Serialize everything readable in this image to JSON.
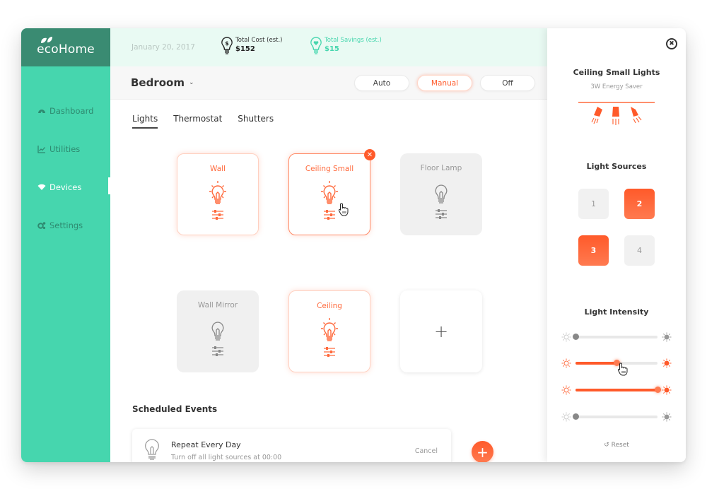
{
  "app": {
    "name": "ecoHome"
  },
  "header": {
    "date": "January 20, 2017",
    "total_cost": {
      "label": "Total Cost (est.)",
      "value": "$152"
    },
    "total_savings": {
      "label": "Total Savings (est.)",
      "value": "$15"
    }
  },
  "sidebar": {
    "items": [
      {
        "label": "Dashboard",
        "icon": "dashboard-gauge-icon",
        "active": false
      },
      {
        "label": "Utilities",
        "icon": "line-chart-icon",
        "active": false
      },
      {
        "label": "Devices",
        "icon": "wifi-icon",
        "active": true
      },
      {
        "label": "Settings",
        "icon": "gears-icon",
        "active": false
      }
    ]
  },
  "room": {
    "name": "Bedroom",
    "modes": [
      {
        "label": "Auto",
        "active": false
      },
      {
        "label": "Manual",
        "active": true
      },
      {
        "label": "Off",
        "active": false
      }
    ]
  },
  "tabs": [
    {
      "label": "Lights",
      "active": true
    },
    {
      "label": "Thermostat",
      "active": false
    },
    {
      "label": "Shutters",
      "active": false
    }
  ],
  "devices": [
    {
      "name": "Wall",
      "state": "on",
      "selected": false
    },
    {
      "name": "Ceiling Small",
      "state": "on",
      "selected": true
    },
    {
      "name": "Floor Lamp",
      "state": "off",
      "selected": false
    },
    {
      "name": "Wall Mirror",
      "state": "off",
      "selected": false
    },
    {
      "name": "Ceiling",
      "state": "on",
      "selected": false
    }
  ],
  "add_device": {
    "symbol": "+"
  },
  "scheduled": {
    "title": "Scheduled Events",
    "events": [
      {
        "title": "Repeat Every Day",
        "detail": "Turn off all light sources at 00:00",
        "action": "Cancel"
      }
    ],
    "add_symbol": "+"
  },
  "panel": {
    "title": "Ceiling Small Lights",
    "subtitle": "3W Energy Saver",
    "sources_title": "Light Sources",
    "sources": [
      {
        "label": "1",
        "on": false
      },
      {
        "label": "2",
        "on": true
      },
      {
        "label": "3",
        "on": true
      },
      {
        "label": "4",
        "on": false
      }
    ],
    "intensity_title": "Light Intensity",
    "intensity": [
      {
        "source": "1",
        "value": 0,
        "on": false
      },
      {
        "source": "2",
        "value": 50,
        "on": true
      },
      {
        "source": "3",
        "value": 100,
        "on": true
      },
      {
        "source": "4",
        "value": 0,
        "on": false
      }
    ],
    "reset_label": "Reset",
    "close_symbol": "✖"
  },
  "colors": {
    "accent": "#ff5a2a",
    "sidebar": "#46d6ae",
    "logo_bg": "#3a8b72",
    "header_bg": "#e9faf3"
  }
}
